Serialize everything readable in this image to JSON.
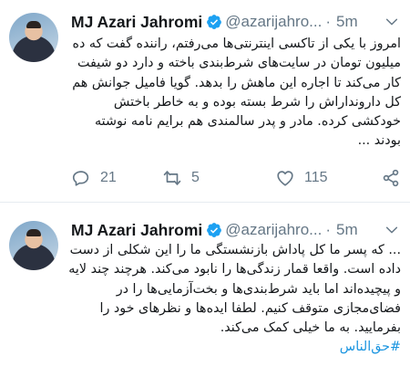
{
  "tweets": [
    {
      "author": {
        "name": "MJ Azari Jahromi",
        "handle": "@azarijahro...",
        "time": "5m",
        "separator": "·"
      },
      "text": "امروز با یکی از تاکسی اینترنتی‌ها می‌رفتم، راننده گفت که ده میلیون تومان در سایت‌های شرط‌بندی باخته و دارد دو شیفت کار می‌کند تا اجاره این ماهش را بدهد. گویا فامیل جوانش هم کل دارونداراش را شرط بسته بوده و به خاطر باختش خودکشی کرده. مادر و پدر سالمندی هم برایم نامه نوشته بودند ...",
      "actions": {
        "replies": "21",
        "retweets": "5",
        "likes": "115"
      }
    },
    {
      "author": {
        "name": "MJ Azari Jahromi",
        "handle": "@azarijahro...",
        "time": "5m",
        "separator": "·"
      },
      "text": "... که پسر ما کل پاداش بازنشستگی ما را این شکلی از دست داده است. واقعا قمار زندگی‌ها را نابود می‌کند. هرچند چند لایه و پیچیده‌اند اما باید شرط‌بندی‌ها و بخت‌آزمایی‌ها را در فضای‌مجازی متوقف کنیم. لطفا ایده‌ها و نظرهای خود را بفرمایید. به ما خیلی کمک می‌کند.",
      "hashtag": "#حق‌الناس"
    }
  ],
  "colors": {
    "verified": "#1da1f2",
    "hashtag": "#1b95e0",
    "secondary": "#657786"
  },
  "icons": [
    "verified-badge-icon",
    "chevron-down-icon",
    "reply-icon",
    "retweet-icon",
    "like-icon",
    "share-icon"
  ]
}
